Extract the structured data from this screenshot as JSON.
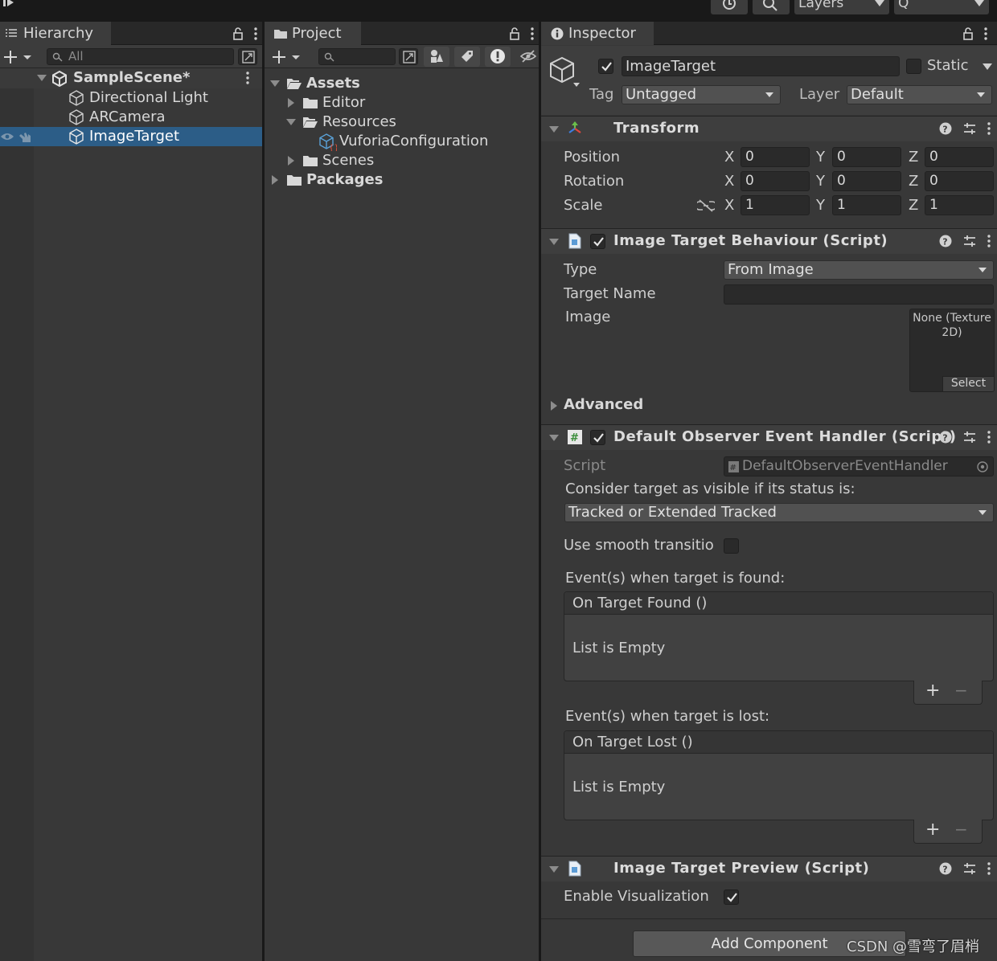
{
  "toolbar": {
    "layers_label": "Layers",
    "layout_label": "Q"
  },
  "hierarchy": {
    "tab_label": "Hierarchy",
    "search_placeholder": "All",
    "scene_name": "SampleScene*",
    "items": [
      {
        "label": "Directional Light"
      },
      {
        "label": "ARCamera"
      },
      {
        "label": "ImageTarget"
      }
    ]
  },
  "project": {
    "tab_label": "Project",
    "tree": {
      "assets": "Assets",
      "editor": "Editor",
      "resources": "Resources",
      "vuforia_config": "VuforiaConfiguration",
      "scenes": "Scenes",
      "packages": "Packages"
    }
  },
  "inspector": {
    "tab_label": "Inspector",
    "object_name": "ImageTarget",
    "static_label": "Static",
    "tag_label": "Tag",
    "tag_value": "Untagged",
    "layer_label": "Layer",
    "layer_value": "Default",
    "transform": {
      "title": "Transform",
      "position_label": "Position",
      "rotation_label": "Rotation",
      "scale_label": "Scale",
      "axis_x": "X",
      "axis_y": "Y",
      "axis_z": "Z",
      "position": {
        "x": "0",
        "y": "0",
        "z": "0"
      },
      "rotation": {
        "x": "0",
        "y": "0",
        "z": "0"
      },
      "scale": {
        "x": "1",
        "y": "1",
        "z": "1"
      }
    },
    "image_target_behaviour": {
      "title": "Image Target Behaviour (Script)",
      "type_label": "Type",
      "type_value": "From Image",
      "target_name_label": "Target Name",
      "target_name_value": "",
      "image_label": "Image",
      "image_none_line1": "None (Texture",
      "image_none_line2": "2D)",
      "select_label": "Select",
      "advanced_label": "Advanced"
    },
    "observer_handler": {
      "title": "Default Observer Event Handler (Script)",
      "script_label": "Script",
      "script_value": "DefaultObserverEventHandler",
      "visible_status_label": "Consider target as visible if its status is:",
      "visible_status_value": "Tracked or Extended Tracked",
      "smooth_label": "Use smooth transition ı",
      "found_label": "Event(s) when target is found:",
      "found_event": "On Target Found ()",
      "found_empty": "List is Empty",
      "lost_label": "Event(s) when target is lost:",
      "lost_event": "On Target Lost ()",
      "lost_empty": "List is Empty",
      "plus": "+",
      "minus": "−"
    },
    "preview": {
      "title": "Image Target Preview (Script)",
      "enable_label": "Enable Visualization"
    },
    "add_component_label": "Add Component"
  },
  "watermark": "CSDN @雪弯了眉梢",
  "colors": {
    "selection": "#2c5d87",
    "panel": "#383838",
    "field": "#2a2a2a"
  }
}
